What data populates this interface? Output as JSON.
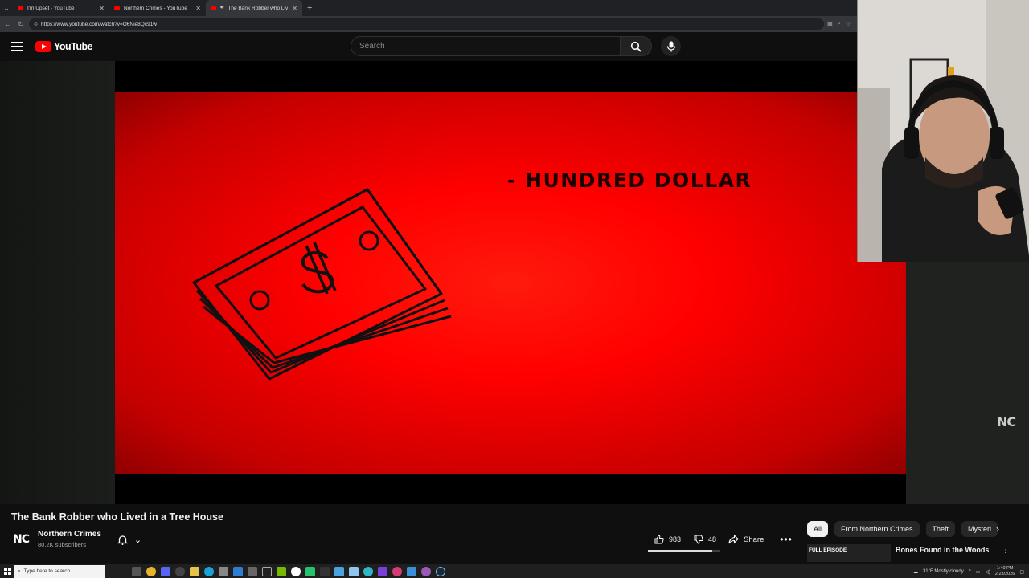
{
  "browser": {
    "tabs": [
      {
        "title": "I'm Upset - YouTube",
        "active": false
      },
      {
        "title": "Northern Crimes - YouTube",
        "active": false
      },
      {
        "title": "The Bank Robber who Lived i…",
        "active": true
      }
    ],
    "url": "https://www.youtube.com/watch?v=O6Nie8Qc91w"
  },
  "youtube": {
    "logo_text": "YouTube",
    "search_placeholder": "Search"
  },
  "video": {
    "frame_caption": "- HUNDRED DOLLAR",
    "watermark": "NC",
    "title": "The Bank Robber who Lived in a Tree House"
  },
  "channel": {
    "avatar_text": "NC",
    "name": "Northern Crimes",
    "subscribers": "80.2K subscribers"
  },
  "actions": {
    "likes": "983",
    "dislikes": "48",
    "share_label": "Share",
    "more_label": "•••"
  },
  "chips": [
    "All",
    "From Northern Crimes",
    "Theft",
    "Mysteri"
  ],
  "recommendation": {
    "thumb_label": "FULL EPISODE",
    "title": "Bones Found in the Woods"
  },
  "taskbar": {
    "search_placeholder": "Type here to search",
    "weather": "31°F  Mostly cloudy",
    "time": "1:40 PM",
    "date": "2/23/2026"
  },
  "colors": {
    "youtube_red": "#ff0000",
    "frame_red": "#ff0000",
    "background": "#0f0f0f"
  }
}
